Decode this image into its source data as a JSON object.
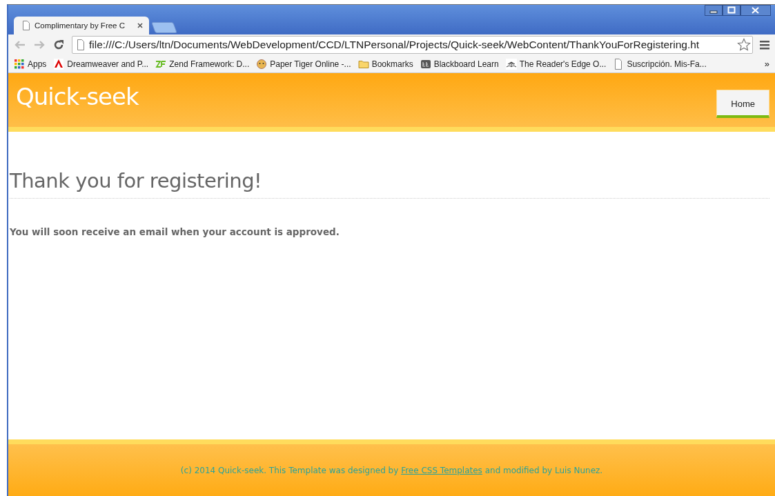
{
  "browser": {
    "tabs": [
      {
        "title": "Complimentary by Free C",
        "selected": true
      },
      {
        "selected": false
      }
    ],
    "address_bar": {
      "value": "file:///C:/Users/ltn/Documents/WebDevelopment/CCD/LTNPersonal/Projects/Quick-seek/WebContent/ThankYouForRegistering.ht"
    },
    "bookmarks": [
      {
        "kind": "apps",
        "label": "Apps"
      },
      {
        "kind": "adobe",
        "label": "Dreamweaver and P..."
      },
      {
        "kind": "zend",
        "label": "Zend Framework: D..."
      },
      {
        "kind": "tiger",
        "label": "Paper Tiger Online -..."
      },
      {
        "kind": "folder",
        "label": "Bookmarks"
      },
      {
        "kind": "bb",
        "label": "Blackboard Learn"
      },
      {
        "kind": "book",
        "label": "The Reader's Edge O..."
      },
      {
        "kind": "page",
        "label": "Suscripción. Mis-Fa..."
      }
    ],
    "bookmarks_overflow": "»"
  },
  "page": {
    "site_title": "Quick-seek",
    "nav": [
      {
        "label": "Home",
        "selected": true
      }
    ],
    "heading": "Thank you for registering!",
    "message": "You will soon receive an email when your account is approved.",
    "footer": {
      "text_before": "(c) 2014 Quick-seek. This Template was designed by",
      "link": "Free CSS Templates",
      "text_after": "and modified by Luis Nunez."
    }
  }
}
